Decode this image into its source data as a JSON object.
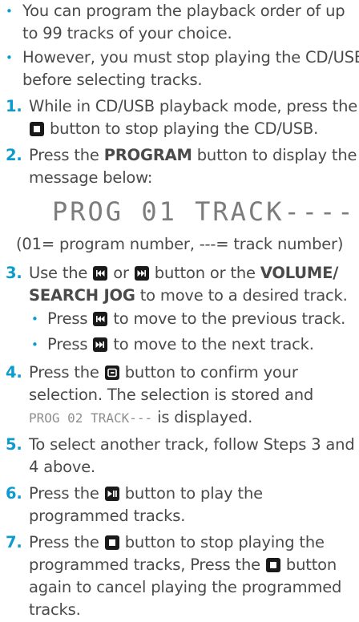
{
  "intro": [
    {
      "bullet": "•",
      "lines": [
        "You can program the playback order of up",
        "to 99 tracks of your choice."
      ]
    },
    {
      "bullet": "•",
      "lines": [
        "However, you must stop playing the CD/USB",
        "before selecting tracks."
      ]
    }
  ],
  "steps": {
    "s1": {
      "num": "1.",
      "l1": "While in CD/USB playback mode, press the",
      "l2": "button to stop playing the CD/USB."
    },
    "s2": {
      "num": "2.",
      "l1a": "Press the ",
      "l1b": "PROGRAM",
      "l1c": " button to display the",
      "l2": "message below:"
    },
    "display": "PROG 01 TRACK----",
    "legend": "(01= program number, ---= track number)",
    "s3": {
      "num": "3.",
      "l1a": "Use the ",
      "l1b": " or ",
      "l1c": " button or the ",
      "l1d": "VOLUME/",
      "l2a": "SEARCH JOG",
      "l2b": " to move to a desired track."
    },
    "s3a": {
      "bullet": "•",
      "a": "Press ",
      "b": " to move to the previous track."
    },
    "s3b": {
      "bullet": "•",
      "a": "Press ",
      "b": " to move to the next track."
    },
    "s4": {
      "num": "4.",
      "l1a": "Press the ",
      "l1b": " button to confirm your",
      "l2": "selection. The selection is stored and",
      "l3a": "PROG 02 TRACK---",
      "l3b": " is displayed."
    },
    "s5": {
      "num": "5.",
      "l1": "To select another track, follow Steps 3 and",
      "l2": "4 above."
    },
    "s6": {
      "num": "6.",
      "l1a": "Press the ",
      "l1b": " button to play the",
      "l2": "programmed tracks."
    },
    "s7": {
      "num": "7.",
      "l1a": "Press the ",
      "l1b": " button to stop playing the",
      "l2a": "programmed tracks, Press the ",
      "l2b": " button",
      "l3": "again to cancel playing the programmed",
      "l4": "tracks."
    }
  },
  "icons": [
    "stop-icon",
    "previous-icon",
    "next-icon",
    "enter-icon",
    "play-pause-icon"
  ],
  "colors": {
    "text": "#4a4a4a",
    "accent": "#0b9ccf",
    "lcd": "#8e8e8e",
    "icon_bg": "#1a1a1a"
  }
}
